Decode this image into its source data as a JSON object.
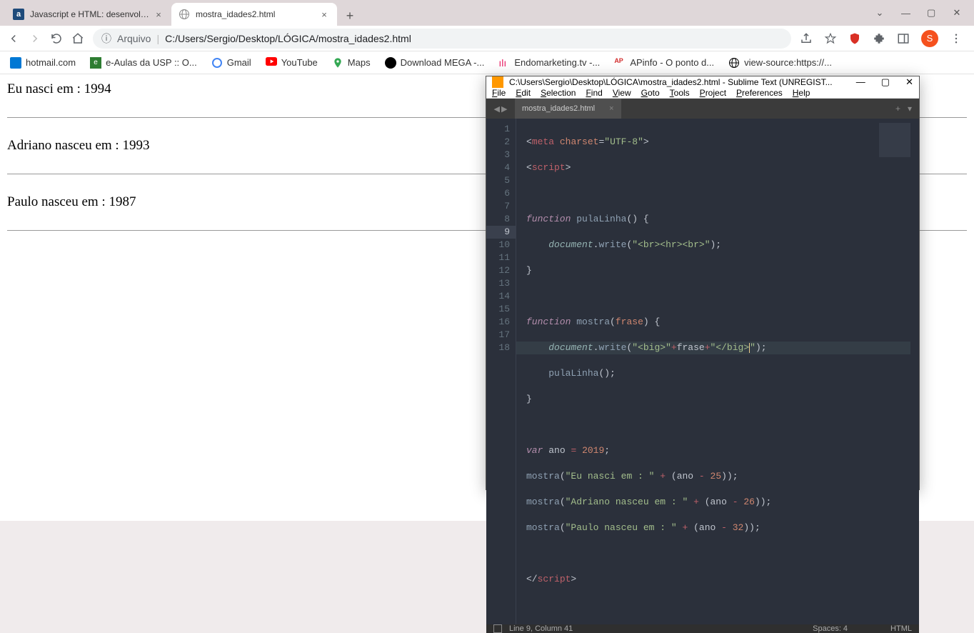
{
  "browser": {
    "tabs": [
      {
        "label": "Javascript e HTML: desenvolva u",
        "favicon_bg": "#1e4a7a",
        "favicon_text": "a",
        "active": false
      },
      {
        "label": "mostra_idades2.html",
        "favicon_text": "🌐",
        "active": true
      }
    ],
    "address": {
      "scheme": "Arquivo",
      "path": "C:/Users/Sergio/Desktop/LÓGICA/mostra_idades2.html",
      "info_text": "ⓘ"
    },
    "bookmarks": [
      {
        "label": "hotmail.com",
        "color": "#0078d4"
      },
      {
        "label": "e-Aulas da USP :: O...",
        "color": "#2e7d32"
      },
      {
        "label": "Gmail",
        "color": "#4285f4"
      },
      {
        "label": "YouTube",
        "color": "#ff0000"
      },
      {
        "label": "Maps",
        "color": "#34a853"
      },
      {
        "label": "Download MEGA -...",
        "color": "#000"
      },
      {
        "label": "Endomarketing.tv -...",
        "color": "#e91e63"
      },
      {
        "label": "APinfo - O ponto d...",
        "color": "#d32f2f",
        "text": "AP"
      },
      {
        "label": "view-source:https://...",
        "color": "#000"
      }
    ],
    "avatar": "S"
  },
  "page": {
    "lines": [
      "Eu nasci em : 1994",
      "Adriano nasceu em : 1993",
      "Paulo nasceu em : 1987"
    ]
  },
  "sublime": {
    "title": "C:\\Users\\Sergio\\Desktop\\LÓGICA\\mostra_idades2.html - Sublime Text (UNREGIST...",
    "menu": [
      "File",
      "Edit",
      "Selection",
      "Find",
      "View",
      "Goto",
      "Tools",
      "Project",
      "Preferences",
      "Help"
    ],
    "tab": "mostra_idades2.html",
    "status": {
      "pos": "Line 9, Column 41",
      "spaces": "Spaces: 4",
      "lang": "HTML"
    },
    "code_lines": 18
  }
}
